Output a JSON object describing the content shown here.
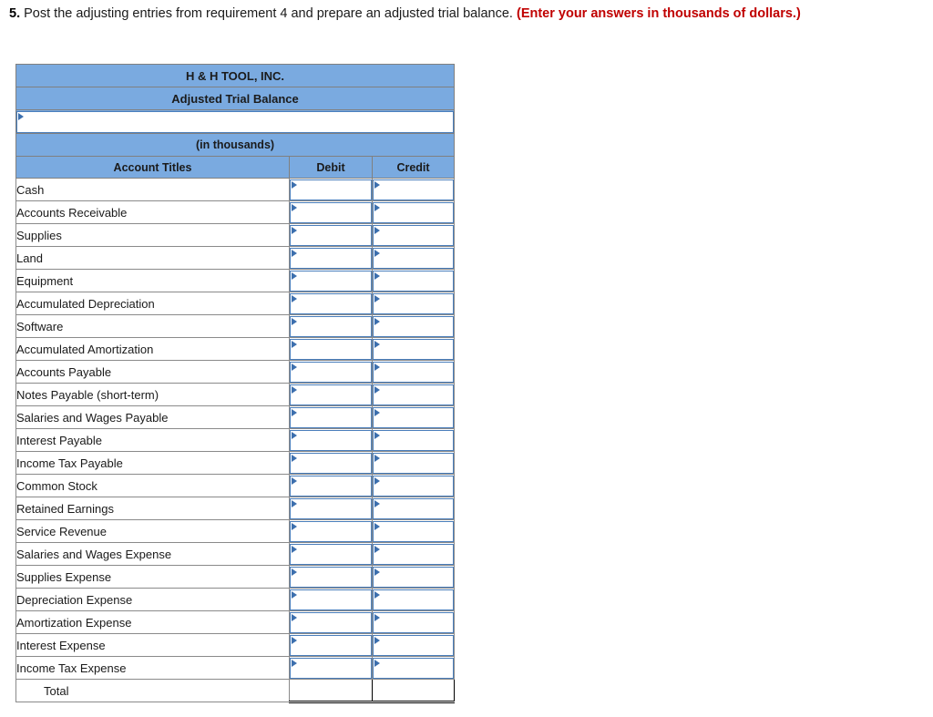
{
  "prompt": {
    "number": "5.",
    "text": "Post the adjusting entries from requirement 4 and prepare an adjusted trial balance.",
    "note": "(Enter your answers in thousands of dollars.)"
  },
  "colors": {
    "header_blue": "#7aaae0",
    "input_border_blue": "#4a7ebb",
    "note_red": "#c00000",
    "cell_border_gray": "#8a8a8a"
  },
  "table": {
    "company_name": "H & H TOOL, INC.",
    "statement_title": "Adjusted Trial Balance",
    "period_value": "",
    "period_placeholder": "",
    "units_label": "(in thousands)",
    "columns": [
      "Account Titles",
      "Debit",
      "Credit"
    ],
    "rows": [
      {
        "title": "Cash",
        "debit": "",
        "credit": ""
      },
      {
        "title": "Accounts Receivable",
        "debit": "",
        "credit": ""
      },
      {
        "title": "Supplies",
        "debit": "",
        "credit": ""
      },
      {
        "title": "Land",
        "debit": "",
        "credit": ""
      },
      {
        "title": "Equipment",
        "debit": "",
        "credit": ""
      },
      {
        "title": "Accumulated Depreciation",
        "debit": "",
        "credit": ""
      },
      {
        "title": "Software",
        "debit": "",
        "credit": ""
      },
      {
        "title": "Accumulated Amortization",
        "debit": "",
        "credit": ""
      },
      {
        "title": "Accounts Payable",
        "debit": "",
        "credit": ""
      },
      {
        "title": "Notes Payable (short-term)",
        "debit": "",
        "credit": ""
      },
      {
        "title": "Salaries and Wages Payable",
        "debit": "",
        "credit": ""
      },
      {
        "title": "Interest Payable",
        "debit": "",
        "credit": ""
      },
      {
        "title": "Income Tax Payable",
        "debit": "",
        "credit": ""
      },
      {
        "title": "Common Stock",
        "debit": "",
        "credit": ""
      },
      {
        "title": "Retained Earnings",
        "debit": "",
        "credit": ""
      },
      {
        "title": "Service Revenue",
        "debit": "",
        "credit": ""
      },
      {
        "title": "Salaries and Wages Expense",
        "debit": "",
        "credit": ""
      },
      {
        "title": "Supplies Expense",
        "debit": "",
        "credit": ""
      },
      {
        "title": "Depreciation Expense",
        "debit": "",
        "credit": ""
      },
      {
        "title": "Amortization Expense",
        "debit": "",
        "credit": ""
      },
      {
        "title": "Interest Expense",
        "debit": "",
        "credit": ""
      },
      {
        "title": "Income Tax Expense",
        "debit": "",
        "credit": ""
      }
    ],
    "total_row": {
      "title": "Total",
      "debit": "",
      "credit": ""
    }
  }
}
